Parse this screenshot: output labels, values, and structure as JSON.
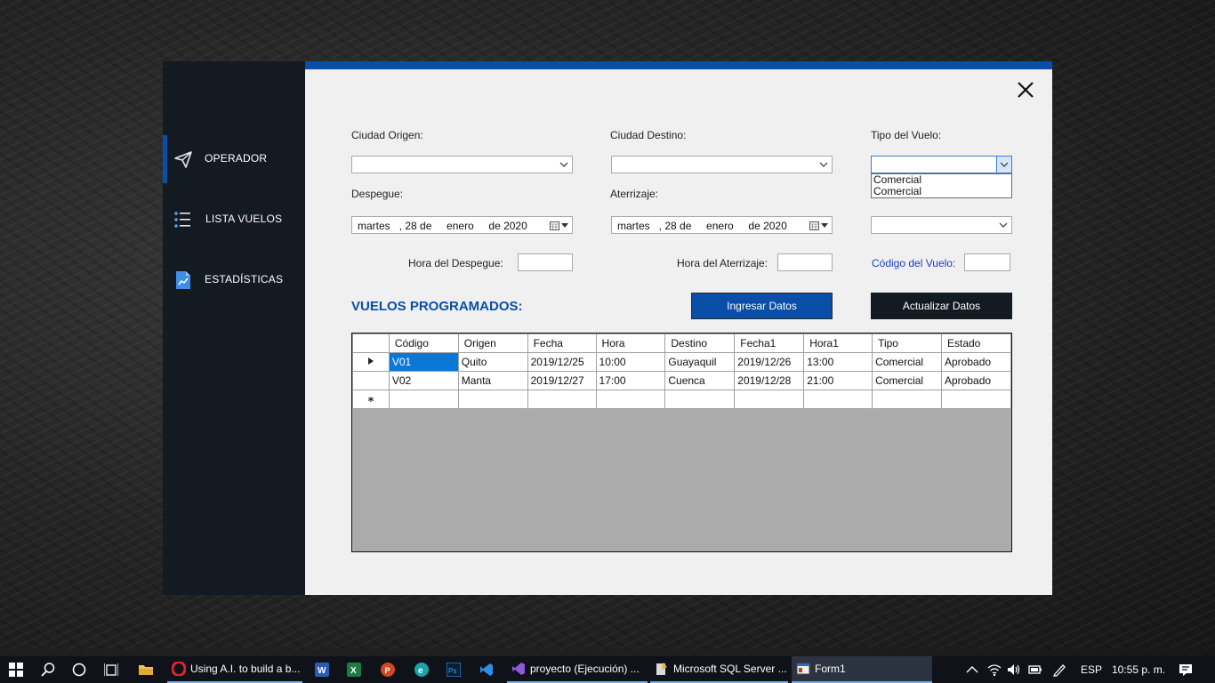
{
  "sidebar": {
    "items": [
      {
        "label": "OPERADOR",
        "icon": "paper-plane-icon",
        "active": true
      },
      {
        "label": "LISTA VUELOS",
        "icon": "list-icon",
        "active": false
      },
      {
        "label": "ESTADÍSTICAS",
        "icon": "chart-file-icon",
        "active": false
      }
    ]
  },
  "form": {
    "origin_label": "Ciudad Origen:",
    "destination_label": "Ciudad Destino:",
    "flight_type_label": "Tipo del Vuelo:",
    "flight_type_options": [
      "Comercial",
      "Comercial"
    ],
    "takeoff_label": "Despegue:",
    "landing_label": "Aterrizaje:",
    "takeoff_date": "martes   , 28 de     enero     de 2020",
    "landing_date": "martes   , 28 de     enero     de 2020",
    "takeoff_time_label": "Hora del Despegue:",
    "landing_time_label": "Hora del Aterrizaje:",
    "flight_code_label": "Código del Vuelo:"
  },
  "section_title": "VUELOS PROGRAMADOS:",
  "buttons": {
    "insert": "Ingresar Datos",
    "update": "Actualizar Datos"
  },
  "grid": {
    "columns": [
      "Código",
      "Origen",
      "Fecha",
      "Hora",
      "Destino",
      "Fecha1",
      "Hora1",
      "Tipo",
      "Estado"
    ],
    "rows": [
      [
        "V01",
        "Quito",
        "2019/12/25",
        "10:00",
        "Guayaquil",
        "2019/12/26",
        "13:00",
        "Comercial",
        "Aprobado"
      ],
      [
        "V02",
        "Manta",
        "2019/12/27",
        "17:00",
        "Cuenca",
        "2019/12/28",
        "21:00",
        "Comercial",
        "Aprobado"
      ]
    ]
  },
  "taskbar": {
    "apps": [
      {
        "label": "Using A.I. to build a b...",
        "icon": "opera-icon"
      },
      {
        "label": "",
        "icon": "word-icon"
      },
      {
        "label": "",
        "icon": "excel-icon"
      },
      {
        "label": "",
        "icon": "powerpoint-icon"
      },
      {
        "label": "",
        "icon": "edge-icon"
      },
      {
        "label": "",
        "icon": "photoshop-icon"
      },
      {
        "label": "",
        "icon": "vscode-icon"
      },
      {
        "label": "proyecto (Ejecución) ...",
        "icon": "visual-studio-icon"
      },
      {
        "label": "Microsoft SQL Server ...",
        "icon": "sql-server-icon"
      },
      {
        "label": "Form1",
        "icon": "form-icon"
      }
    ],
    "language": "ESP",
    "time": "10:55 p. m."
  },
  "colors": {
    "accent": "#0a4ea8",
    "sidebar_bg": "#141a22",
    "form_bg": "#f0f0f0",
    "selected_cell": "#0a78d7"
  }
}
